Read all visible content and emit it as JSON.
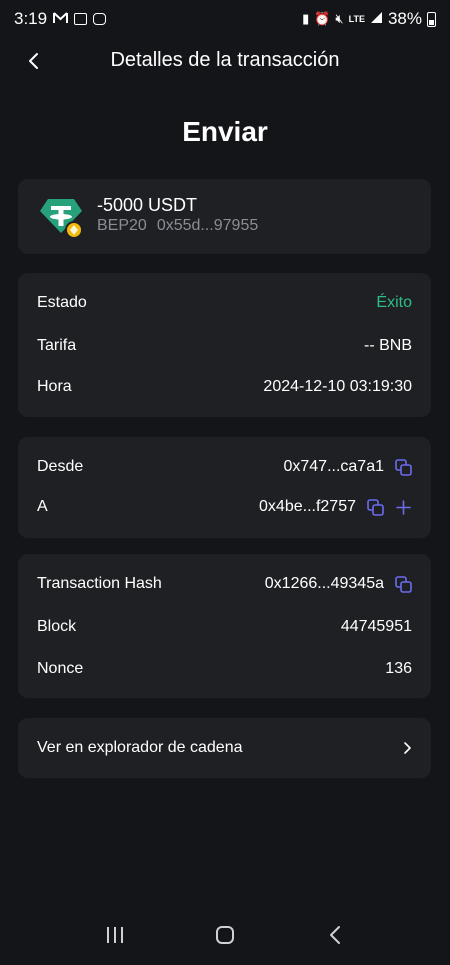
{
  "status_bar": {
    "time": "3:19",
    "battery": "38%",
    "network": "LTE"
  },
  "header": {
    "title": "Detalles de la transacción"
  },
  "page_title": "Enviar",
  "token": {
    "amount": "-5000 USDT",
    "network": "BEP20",
    "address": "0x55d...97955"
  },
  "details": {
    "status_label": "Estado",
    "status_value": "Éxito",
    "fee_label": "Tarifa",
    "fee_value": "-- BNB",
    "time_label": "Hora",
    "time_value": "2024-12-10 03:19:30"
  },
  "addresses": {
    "from_label": "Desde",
    "from_value": "0x747...ca7a1",
    "to_label": "A",
    "to_value": "0x4be...f2757"
  },
  "chain_info": {
    "hash_label": "Transaction Hash",
    "hash_value": "0x1266...49345a",
    "block_label": "Block",
    "block_value": "44745951",
    "nonce_label": "Nonce",
    "nonce_value": "136"
  },
  "explorer": {
    "label": "Ver en explorador de cadena"
  },
  "colors": {
    "background": "#141518",
    "card": "#1f2024",
    "success": "#2ebd85",
    "accent": "#6b6cf0",
    "tether": "#26a17b"
  }
}
